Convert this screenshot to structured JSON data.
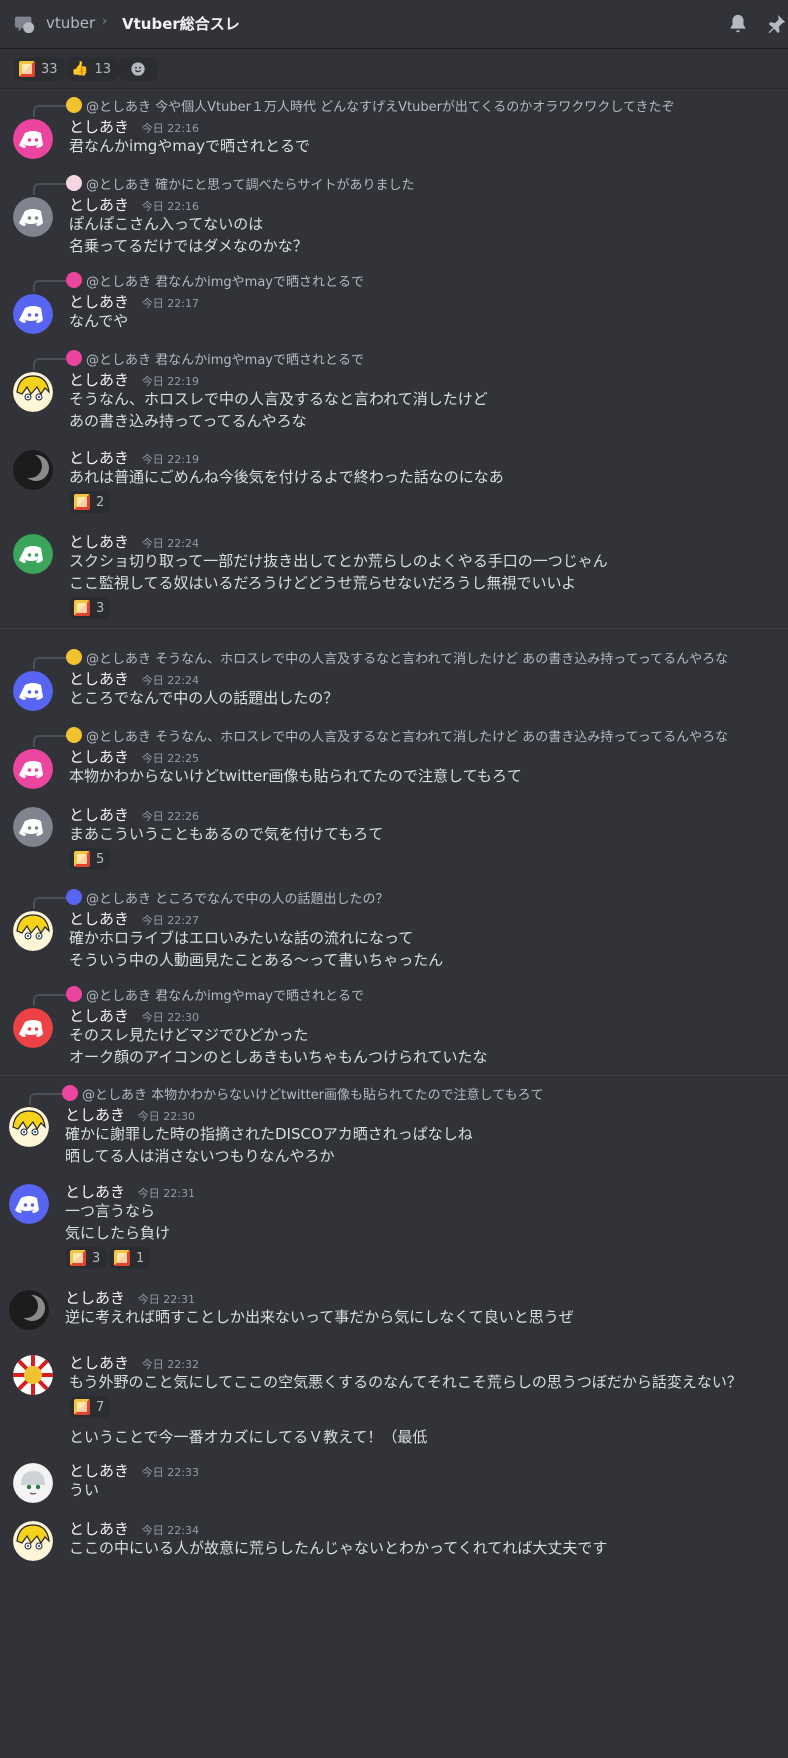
{
  "header": {
    "parent_channel": "vtuber",
    "thread_title": "Vtuber総合スレ"
  },
  "top_reactions": [
    {
      "icon": "custom-emote",
      "count": "33"
    },
    {
      "icon": "thumbs-up-emoji",
      "count": "13"
    },
    {
      "icon": "add-reaction-icon",
      "count": ""
    }
  ],
  "colors": {
    "background": "#313338",
    "pink": "#eb459f",
    "gray": "#80848e",
    "blurple": "#5865f2",
    "green": "#3ba55c",
    "red": "#ed4245"
  },
  "messages": [
    {
      "reply": "@としあき 今や個人Vtuber１万人時代 どんなすげえVtuberが出てくるのかオラワクワクしてきたぞ",
      "author": "としあき",
      "time": "今日 22:16",
      "lines": [
        "君なんかimgやmayで晒されとるで"
      ],
      "reactions": []
    },
    {
      "reply": "@としあき 確かにと思って調べたらサイトがありました",
      "author": "としあき",
      "time": "今日 22:16",
      "lines": [
        "ぽんぽこさん入ってないのは",
        "名乗ってるだけではダメなのかな？"
      ],
      "reactions": []
    },
    {
      "reply": "@としあき 君なんかimgやmayで晒されとるで",
      "author": "としあき",
      "time": "今日 22:17",
      "lines": [
        "なんでや"
      ],
      "reactions": []
    },
    {
      "reply": "@としあき 君なんかimgやmayで晒されとるで",
      "author": "としあき",
      "time": "今日 22:19",
      "lines": [
        "そうなん、ホロスレで中の人言及するなと言われて消したけど",
        "あの書き込み持ってってるんやろな"
      ],
      "reactions": []
    },
    {
      "reply": "",
      "author": "としあき",
      "time": "今日 22:19",
      "lines": [
        "あれは普通にごめんね今後気を付けるよで終わった話なのになあ"
      ],
      "reactions": [
        "2"
      ]
    },
    {
      "reply": "",
      "author": "としあき",
      "time": "今日 22:24",
      "lines": [
        "スクショ切り取って一部だけ抜き出してとか荒らしのよくやる手口の一つじゃん",
        "ここ監視してる奴はいるだろうけどどうせ荒らせないだろうし無視でいいよ"
      ],
      "reactions": [
        "3"
      ]
    },
    {
      "reply": "@としあき そうなん、ホロスレで中の人言及するなと言われて消したけど あの書き込み持ってってるんやろな",
      "author": "としあき",
      "time": "今日 22:24",
      "lines": [
        "ところでなんで中の人の話題出したの？"
      ],
      "reactions": []
    },
    {
      "reply": "@としあき そうなん、ホロスレで中の人言及するなと言われて消したけど あの書き込み持ってってるんやろな",
      "author": "としあき",
      "time": "今日 22:25",
      "lines": [
        "本物かわからないけどtwitter画像も貼られてたので注意してもろて"
      ],
      "reactions": []
    },
    {
      "reply": "",
      "author": "としあき",
      "time": "今日 22:26",
      "lines": [
        "まあこういうこともあるので気を付けてもろて"
      ],
      "reactions": [
        "5"
      ]
    },
    {
      "reply": "@としあき ところでなんで中の人の話題出したの？",
      "author": "としあき",
      "time": "今日 22:27",
      "lines": [
        "確かホロライブはエロいみたいな話の流れになって",
        "そういう中の人動画見たことある～って書いちゃったん"
      ],
      "reactions": []
    },
    {
      "reply": "@としあき 君なんかimgやmayで晒されとるで",
      "author": "としあき",
      "time": "今日 22:30",
      "lines": [
        "そのスレ見たけどマジでひどかった",
        "オーク顔のアイコンのとしあきもいちゃもんつけられていたな"
      ],
      "reactions": []
    },
    {
      "reply": "@としあき 本物かわからないけどtwitter画像も貼られてたので注意してもろて",
      "author": "としあき",
      "time": "今日 22:30",
      "lines": [
        "確かに謝罪した時の指摘されたDISCOアカ晒されっぱなしね",
        "晒してる人は消さないつもりなんやろか"
      ],
      "reactions": []
    },
    {
      "reply": "",
      "author": "としあき",
      "time": "今日 22:31",
      "lines": [
        "一つ言うなら",
        "気にしたら負け"
      ],
      "reactions": [
        "3",
        "1"
      ]
    },
    {
      "reply": "",
      "author": "としあき",
      "time": "今日 22:31",
      "lines": [
        "逆に考えれば晒すことしか出来ないって事だから気にしなくて良いと思うぜ"
      ],
      "reactions": []
    },
    {
      "reply": "",
      "author": "としあき",
      "time": "今日 22:32",
      "lines": [
        "もう外野のこと気にしてここの空気悪くするのなんてそれこそ荒らしの思うつぼだから話変えない？"
      ],
      "reactions": [
        "7"
      ],
      "followup": "ということで今一番オカズにしてるＶ教えて！（最低"
    },
    {
      "reply": "",
      "author": "としあき",
      "time": "今日 22:33",
      "lines": [
        "うい"
      ],
      "reactions": []
    },
    {
      "reply": "",
      "author": "としあき",
      "time": "今日 22:34",
      "lines": [
        "ここの中にいる人が故意に荒らしたんじゃないとわかってくれてれば大丈夫です"
      ],
      "reactions": []
    }
  ]
}
